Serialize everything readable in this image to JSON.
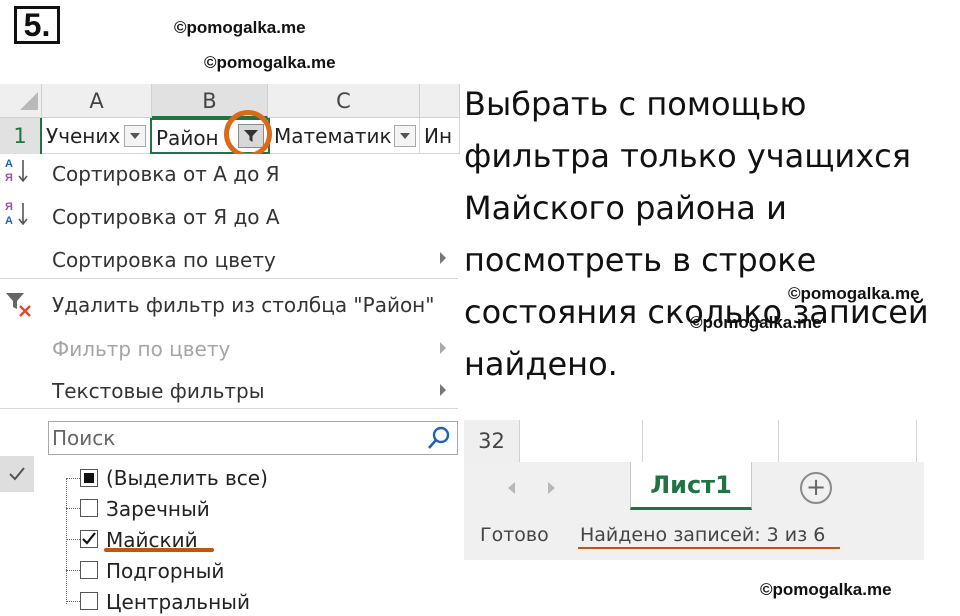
{
  "task_number": "5.",
  "watermark": "©pomogalka.me",
  "sheet": {
    "columns": [
      "A",
      "B",
      "C"
    ],
    "row_number": "1",
    "headers": [
      "Учених",
      "Район",
      "Математик",
      "Ин"
    ]
  },
  "menu": {
    "sort_asc": "Сортировка от А до Я",
    "sort_desc": "Сортировка от Я до А",
    "sort_color": "Сортировка по цвету",
    "clear_filter": "Удалить фильтр из столбца \"Район\"",
    "filter_color": "Фильтр по цвету",
    "text_filters": "Текстовые фильтры",
    "search_placeholder": "Поиск",
    "items": [
      {
        "label": "(Выделить все)",
        "state": "indeterminate"
      },
      {
        "label": "Заречный",
        "state": "unchecked"
      },
      {
        "label": "Майский",
        "state": "checked"
      },
      {
        "label": "Подгорный",
        "state": "unchecked"
      },
      {
        "label": "Центральный",
        "state": "unchecked"
      }
    ]
  },
  "instruction": "Выбрать с помощью фильтра только учащихся Майского района и посмотреть в строке состояния сколько записей найдено.",
  "bottom": {
    "row_number": "32",
    "sheet_tab": "Лист1",
    "add_sheet": "+",
    "status_ready": "Готово",
    "status_found": "Найдено записей: 3 из 6"
  },
  "colors": {
    "accent": "#217346",
    "highlight": "#d96a17"
  }
}
